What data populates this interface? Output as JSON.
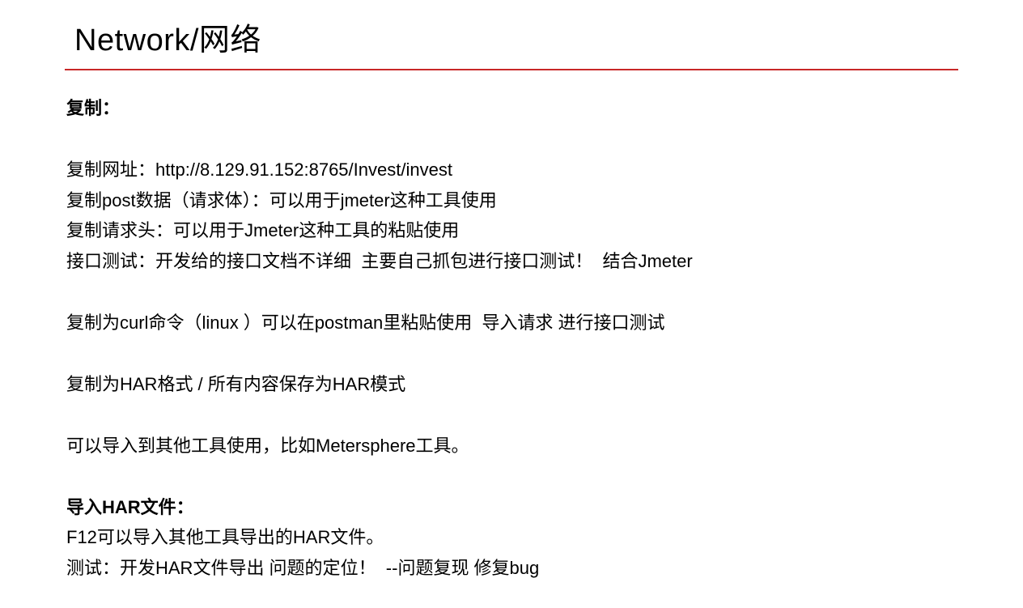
{
  "slide": {
    "title": "Network/网络",
    "section1_heading": "复制：",
    "section1_lines": [
      "复制网址：http://8.129.91.152:8765/Invest/invest",
      "复制post数据（请求体）：可以用于jmeter这种工具使用",
      "复制请求头：可以用于Jmeter这种工具的粘贴使用",
      "接口测试：开发给的接口文档不详细  主要自己抓包进行接口测试！  结合Jmeter"
    ],
    "section1_extra1": "复制为curl命令（linux ）可以在postman里粘贴使用  导入请求 进行接口测试",
    "section1_extra2": "复制为HAR格式 / 所有内容保存为HAR模式",
    "section1_extra3": "可以导入到其他工具使用，比如Metersphere工具。",
    "section2_heading": "导入HAR文件：",
    "section2_lines": [
      "F12可以导入其他工具导出的HAR文件。",
      "测试：开发HAR文件导出 问题的定位！  --问题复现 修复bug"
    ]
  }
}
